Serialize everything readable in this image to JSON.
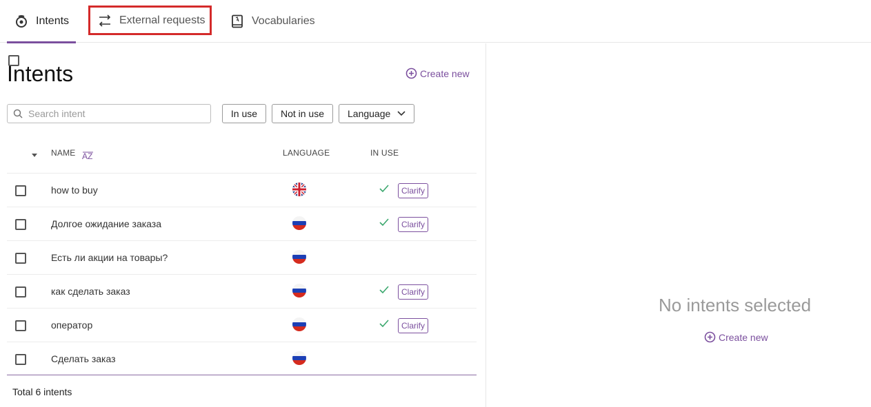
{
  "tabs": [
    {
      "label": "Intents",
      "icon": "intents-gear-icon",
      "active": true
    },
    {
      "label": "External requests",
      "icon": "api-exchange-icon",
      "active": false
    },
    {
      "label": "Vocabularies",
      "icon": "book-icon",
      "active": false
    }
  ],
  "page": {
    "title": "Intents",
    "create_new_label": "Create new",
    "search_placeholder": "Search intent",
    "filters": {
      "in_use": "In use",
      "not_in_use": "Not in use",
      "language": "Language"
    }
  },
  "table": {
    "columns": {
      "name": "NAME",
      "sort_label": "A-Z",
      "language": "LANGUAGE",
      "in_use": "IN USE"
    },
    "rows": [
      {
        "name": "how to buy",
        "language": "en",
        "in_use": true,
        "badge": "Clarify"
      },
      {
        "name": "Долгое ожидание заказа",
        "language": "ru",
        "in_use": true,
        "badge": "Clarify"
      },
      {
        "name": "Есть ли акции на товары?",
        "language": "ru",
        "in_use": false,
        "badge": ""
      },
      {
        "name": "как сделать заказ",
        "language": "ru",
        "in_use": true,
        "badge": "Clarify"
      },
      {
        "name": "оператор",
        "language": "ru",
        "in_use": true,
        "badge": "Clarify"
      },
      {
        "name": "Сделать заказ",
        "language": "ru",
        "in_use": false,
        "badge": ""
      }
    ],
    "total": "Total 6 intents"
  },
  "detail": {
    "empty_text": "No intents selected",
    "create_new_label": "Create new"
  },
  "colors": {
    "accent": "#7b4f9e",
    "check": "#3aa76d",
    "highlight": "#d42a2a"
  }
}
